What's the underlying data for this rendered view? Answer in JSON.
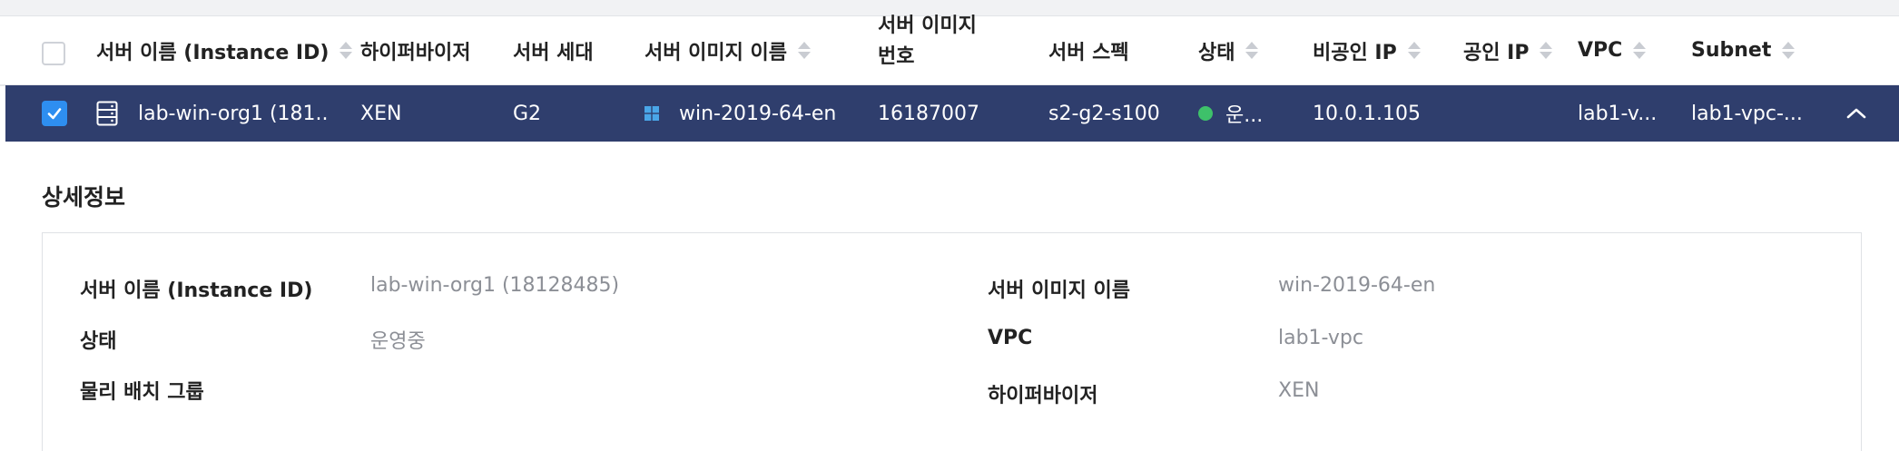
{
  "table": {
    "columns": {
      "server_name": "서버 이름 (Instance ID)",
      "hypervisor": "하이퍼바이저",
      "generation": "서버 세대",
      "image_name": "서버 이미지 이름",
      "image_number_line1": "서버 이미지",
      "image_number_line2": "번호",
      "spec": "서버 스펙",
      "status": "상태",
      "private_ip": "비공인 IP",
      "public_ip": "공인 IP",
      "vpc": "VPC",
      "subnet": "Subnet"
    },
    "rows": [
      {
        "selected": true,
        "server_name": "lab-win-org1 (181...",
        "hypervisor": "XEN",
        "generation": "G2",
        "image_name": "win-2019-64-en",
        "image_number": "16187007",
        "spec": "s2-g2-s100",
        "status": "운...",
        "private_ip": "10.0.1.105",
        "public_ip": "",
        "vpc": "lab1-v...",
        "subnet": "lab1-vpc-..."
      }
    ]
  },
  "detail": {
    "title": "상세정보",
    "left": [
      {
        "label": "서버 이름 (Instance ID)",
        "value": "lab-win-org1 (18128485)"
      },
      {
        "label": "상태",
        "value": "운영중"
      },
      {
        "label": "물리 배치 그룹",
        "value": ""
      }
    ],
    "right": [
      {
        "label": "서버 이미지 이름",
        "value": "win-2019-64-en"
      },
      {
        "label": "VPC",
        "value": "lab1-vpc"
      },
      {
        "label": "하이퍼바이저",
        "value": "XEN"
      }
    ]
  },
  "icons": {
    "server": "server-icon",
    "os": "windows-icon",
    "status": "status-running-dot",
    "collapse": "chevron-up-icon",
    "check": "checkmark-icon"
  },
  "colors": {
    "selected_row_bg": "#2f3e6d",
    "checkbox_checked": "#2e8ef0",
    "status_running": "#3ec16a",
    "windows_blue": "#4aa6e8"
  }
}
